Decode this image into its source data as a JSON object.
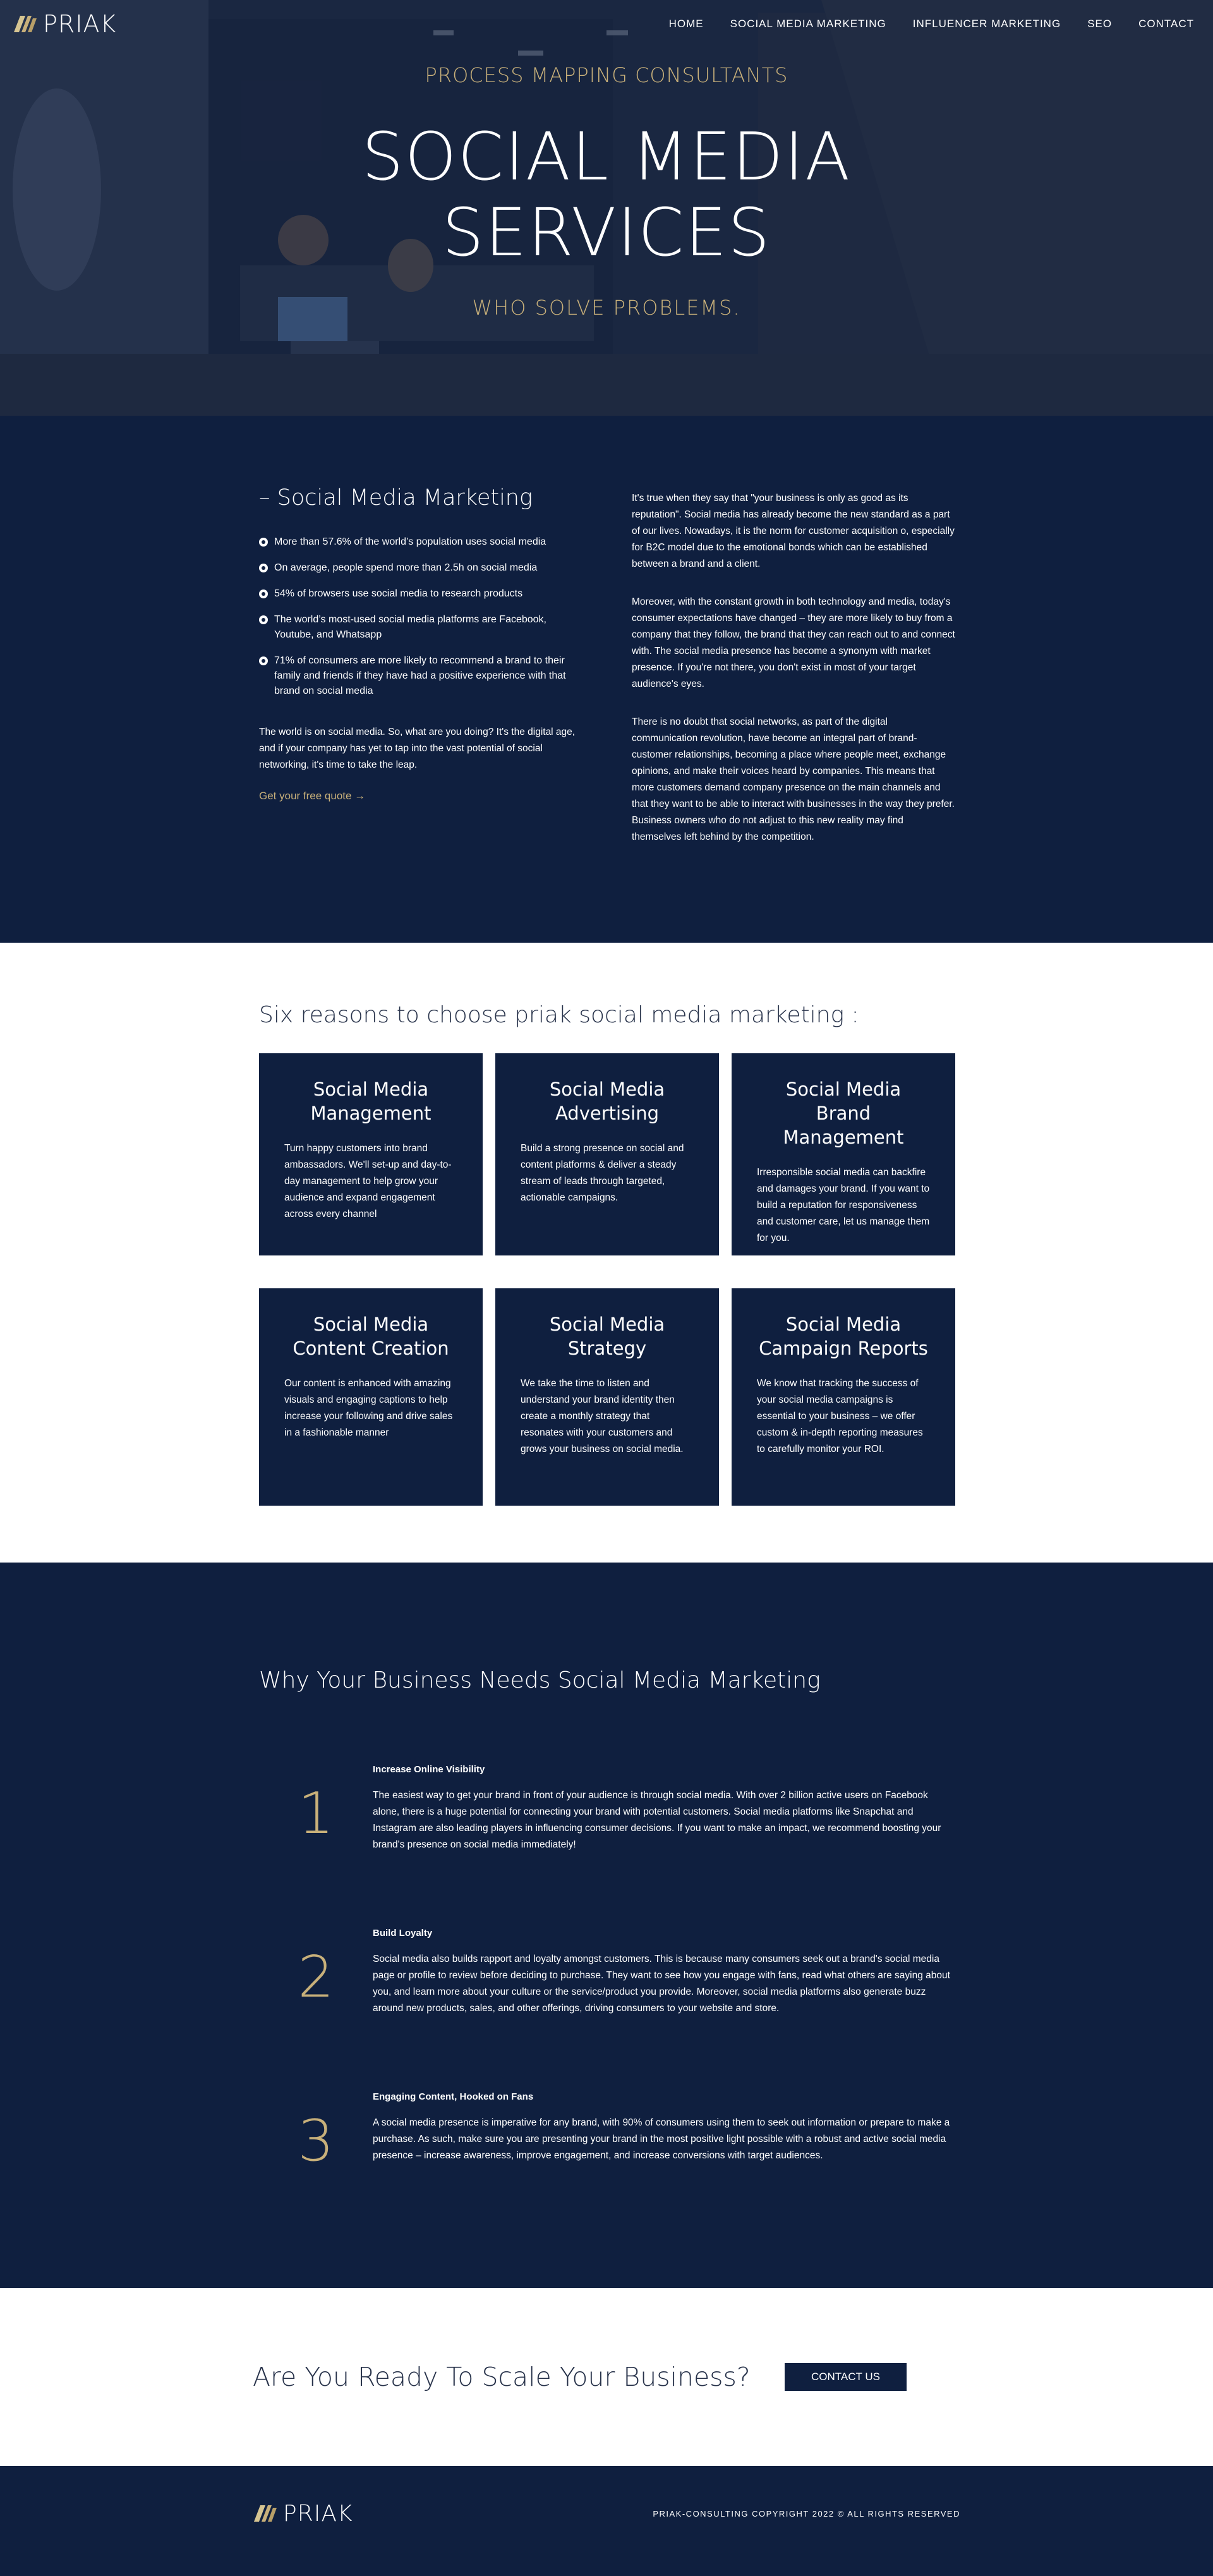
{
  "nav": {
    "logo_text": "PRIAK",
    "items": [
      "HOME",
      "SOCIAL MEDIA MARKETING",
      "INFLUENCER MARKETING",
      "SEO",
      "CONTACT"
    ]
  },
  "hero": {
    "kicker": "PROCESS MAPPING CONSULTANTS",
    "title_line1": "SOCIAL MEDIA",
    "title_line2": "SERVICES",
    "subtitle": "WHO SOLVE PROBLEMS."
  },
  "intro": {
    "heading": "– Social Media Marketing",
    "bullets": [
      "More than 57.6% of the world’s population uses social media",
      "On average, people spend more than 2.5h on social media",
      "54% of browsers use social media to research products",
      "The world’s most-used social media platforms are Facebook, Youtube, and Whatsapp",
      "71% of consumers are more likely to recommend a brand to their family and friends if they have had a positive experience with that brand on social media"
    ],
    "paragraph": "The world is on social media. So, what are you doing? It's the digital age, and if your company has yet to tap into the vast potential of social networking, it's time to take the leap.",
    "link": "Get your free quote →",
    "right_paragraphs": [
      "It's true when they say that \"your business is only as good as its reputation\". Social media has already become the new standard as a part of our lives. Nowadays, it is the norm for customer acquisition o, especially for B2C model due to the emotional bonds which can be established between a brand and a client.",
      "Moreover, with the constant growth in both technology and media, today's consumer expectations have changed – they are more likely to buy from a company that they follow, the brand that they can reach out to and connect with. The social media presence has become a synonym with market presence. If you're not there, you don't exist in most of your target audience's eyes.",
      "There is no doubt that social networks, as part of the digital communication revolution, have become an integral part of brand-customer relationships, becoming a place where people meet, exchange opinions, and make their voices heard by companies. This means that more customers demand company presence on the main channels and that they want to be able to interact with businesses in the way they prefer. Business owners who do not adjust to this new reality may find themselves left behind by the competition."
    ]
  },
  "reasons": {
    "title": "Six reasons to choose priak social media marketing :",
    "cards": [
      {
        "title": "Social Media Management",
        "text": "Turn happy customers into brand ambassadors. We'll set-up and day-to-day management to help grow your audience and expand engagement across every channel"
      },
      {
        "title": "Social Media Advertising",
        "text": "Build a strong presence on social and content platforms & deliver a steady stream of leads through targeted, actionable campaigns."
      },
      {
        "title": "Social Media Brand Management",
        "text": "Irresponsible social media can backfire and damages your brand. If you want to build a reputation for responsiveness and customer care, let us manage them for you."
      },
      {
        "title": "Social Media Content Creation",
        "text": "Our content is enhanced with amazing visuals and engaging captions to help increase your following and drive sales in a fashionable manner"
      },
      {
        "title": "Social Media Strategy",
        "text": "We take the time to listen and understand your brand identity then create a monthly strategy that resonates with your customers and grows your business on social media."
      },
      {
        "title": "Social Media Campaign Reports",
        "text": "We know that tracking the success of your social media campaigns is essential to your business – we offer custom & in-depth reporting measures to carefully monitor your ROI."
      }
    ]
  },
  "why": {
    "title": "Why Your Business Needs Social Media Marketing",
    "items": [
      {
        "number": "1",
        "heading": "Increase Online Visibility",
        "text": "The easiest way to get your brand in front of your audience is through social media. With over 2 billion active users on Facebook alone, there is a huge potential for connecting your brand with potential customers. Social media platforms like Snapchat and Instagram are also leading players in influencing consumer decisions. If you want to make an impact, we recommend boosting your brand's presence on social media immediately!"
      },
      {
        "number": "2",
        "heading": "Build Loyalty",
        "text": "Social media also builds rapport and loyalty amongst customers. This is because many consumers seek out a brand's social media page or profile to review before deciding to purchase. They want to see how you engage with fans, read what others are saying about you, and learn more about your culture or the service/product you provide. Moreover, social media platforms also generate buzz around new products, sales, and other offerings, driving consumers to your website and store."
      },
      {
        "number": "3",
        "heading": "Engaging Content, Hooked on Fans",
        "text": "A social media presence is imperative for any brand, with 90% of consumers using them to seek out information or prepare to make a purchase. As such, make sure you are presenting your brand in the most positive light possible with a robust and active social media presence – increase awareness, improve engagement, and increase conversions with target audiences."
      }
    ]
  },
  "cta": {
    "title": "Are You Ready To Scale Your Business?",
    "button": "CONTACT US"
  },
  "footer": {
    "logo_text": "PRIAK",
    "copyright": "PRIAK-CONSULTING COPYRIGHT 2022 © ALL RIGHTS RESERVED"
  },
  "colors": {
    "navy": "#0f1f3f",
    "gold": "#c8b07a"
  }
}
